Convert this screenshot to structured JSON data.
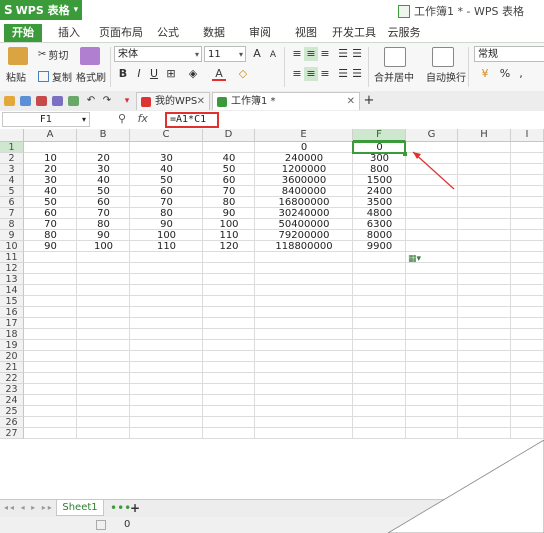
{
  "title_bar": {
    "app_button_label": "WPS 表格",
    "window_title": "工作簿1 * - WPS 表格"
  },
  "menu_tabs": [
    "开始",
    "插入",
    "页面布局",
    "公式",
    "数据",
    "审阅",
    "视图",
    "开发工具",
    "云服务"
  ],
  "ribbon": {
    "paste_label": "粘贴",
    "cut_label": "剪切",
    "copy_label": "复制",
    "format_painter_label": "格式刷",
    "font_name": "宋体",
    "font_size": "11",
    "bold": "B",
    "italic": "I",
    "underline": "U",
    "font_color_letter": "A",
    "merge_center_label": "合并居中",
    "wrap_text_label": "自动换行",
    "number_format": "常规",
    "percent_label": "%"
  },
  "doc_tabs": [
    {
      "label": "我的WPS"
    },
    {
      "label": "工作簿1 *"
    }
  ],
  "formula_bar": {
    "name_box": "F1",
    "fx_label": "fx",
    "formula": "=A1*C1"
  },
  "columns": [
    "A",
    "B",
    "C",
    "D",
    "E",
    "F",
    "G",
    "H",
    "I"
  ],
  "selected_column": "F",
  "selected_row": "1",
  "rows": [
    [
      "",
      "",
      "",
      "",
      "0",
      "0"
    ],
    [
      "10",
      "20",
      "30",
      "40",
      "240000",
      "300"
    ],
    [
      "20",
      "30",
      "40",
      "50",
      "1200000",
      "800"
    ],
    [
      "30",
      "40",
      "50",
      "60",
      "3600000",
      "1500"
    ],
    [
      "40",
      "50",
      "60",
      "70",
      "8400000",
      "2400"
    ],
    [
      "50",
      "60",
      "70",
      "80",
      "16800000",
      "3500"
    ],
    [
      "60",
      "70",
      "80",
      "90",
      "30240000",
      "4800"
    ],
    [
      "70",
      "80",
      "90",
      "100",
      "50400000",
      "6300"
    ],
    [
      "80",
      "90",
      "100",
      "110",
      "79200000",
      "8000"
    ],
    [
      "90",
      "100",
      "110",
      "120",
      "118800000",
      "9900"
    ]
  ],
  "row_numbers": [
    "1",
    "2",
    "3",
    "4",
    "5",
    "6",
    "7",
    "8",
    "9",
    "10",
    "11",
    "12",
    "13",
    "14",
    "15",
    "16",
    "17",
    "18",
    "19",
    "20",
    "21",
    "22",
    "23",
    "24",
    "25",
    "26",
    "27"
  ],
  "sheet_tabs": {
    "active": "Sheet1",
    "dots": "•••",
    "add": "+"
  },
  "status_bar": {
    "value": "0"
  },
  "colors": {
    "brand_green": "#3b9a3a",
    "annotation_red": "#e0312f"
  },
  "icons": [
    "wps-logo-icon",
    "document-icon",
    "paste-icon",
    "scissors-icon",
    "copy-icon",
    "format-painter-icon",
    "merge-center-icon",
    "wrap-text-icon",
    "search-icon",
    "undo-icon",
    "redo-icon",
    "open-icon",
    "save-icon",
    "print-icon",
    "paste-options-icon",
    "plus-icon",
    "calculator-icon"
  ]
}
